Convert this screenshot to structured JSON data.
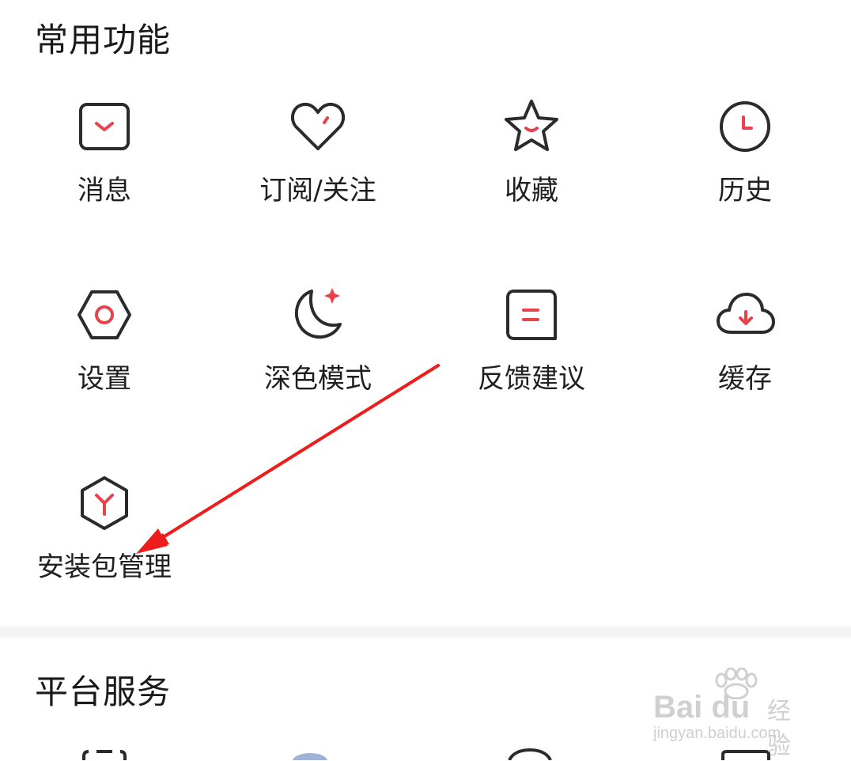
{
  "sections": {
    "common": {
      "title": "常用功能",
      "items": [
        {
          "label": "消息",
          "icon": "message-icon"
        },
        {
          "label": "订阅/关注",
          "icon": "heart-icon"
        },
        {
          "label": "收藏",
          "icon": "star-icon"
        },
        {
          "label": "历史",
          "icon": "clock-icon"
        },
        {
          "label": "设置",
          "icon": "settings-hexagon-icon"
        },
        {
          "label": "深色模式",
          "icon": "moon-icon"
        },
        {
          "label": "反馈建议",
          "icon": "feedback-icon"
        },
        {
          "label": "缓存",
          "icon": "cloud-download-icon"
        },
        {
          "label": "安装包管理",
          "icon": "package-icon"
        }
      ]
    },
    "platform": {
      "title": "平台服务"
    }
  },
  "watermark": {
    "brand": "Bai du",
    "suffix": "经验",
    "url": "jingyan.baidu.com"
  },
  "colors": {
    "accent": "#e8434c",
    "icon_stroke": "#2b2b2b",
    "annotation_arrow": "#ee1c1c"
  }
}
